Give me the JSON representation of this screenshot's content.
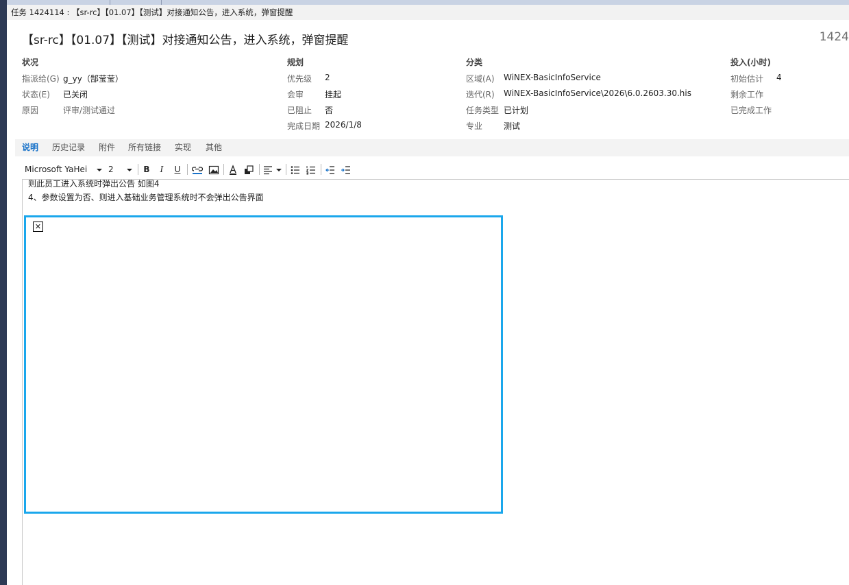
{
  "window": {
    "title": "任务 1424114 : 【sr-rc】【01.07】【测试】对接通知公告，进入系统，弹窗提醒"
  },
  "work_item": {
    "title": "【sr-rc】【01.07】【测试】对接通知公告，进入系统，弹窗提醒",
    "id_partial": "1424"
  },
  "sections": {
    "status": {
      "heading": "状况",
      "fields": [
        {
          "label": "指派给(G)",
          "value": "g_yy（郜莹莹）"
        },
        {
          "label": "状态(E)",
          "value": "已关闭"
        },
        {
          "label": "原因",
          "value": "评审/测试通过"
        }
      ]
    },
    "planning": {
      "heading": "规划",
      "fields": [
        {
          "label": "优先级",
          "value": "2"
        },
        {
          "label": "会审",
          "value": "挂起"
        },
        {
          "label": "已阻止",
          "value": "否"
        },
        {
          "label": "完成日期",
          "value": "2026/1/8"
        }
      ]
    },
    "classification": {
      "heading": "分类",
      "fields": [
        {
          "label": "区域(A)",
          "value": "WiNEX-BasicInfoService"
        },
        {
          "label": "迭代(R)",
          "value": "WiNEX-BasicInfoService\\2026\\6.0.2603.30.his"
        },
        {
          "label": "任务类型",
          "value": "已计划"
        },
        {
          "label": "专业",
          "value": "测试"
        }
      ]
    },
    "effort": {
      "heading": "投入(小时)",
      "fields": [
        {
          "label": "初始估计",
          "value": "4"
        },
        {
          "label": "剩余工作",
          "value": ""
        },
        {
          "label": "已完成工作",
          "value": ""
        }
      ]
    }
  },
  "tabs": [
    {
      "label": "说明",
      "active": true
    },
    {
      "label": "历史记录",
      "active": false
    },
    {
      "label": "附件",
      "active": false
    },
    {
      "label": "所有链接",
      "active": false
    },
    {
      "label": "实现",
      "active": false
    },
    {
      "label": "其他",
      "active": false
    }
  ],
  "toolbar": {
    "font_family": "Microsoft YaHei",
    "font_size": "2",
    "bold": "B",
    "italic": "I",
    "underline": "U"
  },
  "editor": {
    "lines": [
      "则此员工进入系统时弹出公告 如图4",
      "4、参数设置为否、则进入基础业务管理系统时不会弹出公告界面"
    ],
    "image_frame_color": "#1aa7ec"
  },
  "colors": {
    "accent": "#1a73c9",
    "sidebar": "#2d3a55"
  }
}
